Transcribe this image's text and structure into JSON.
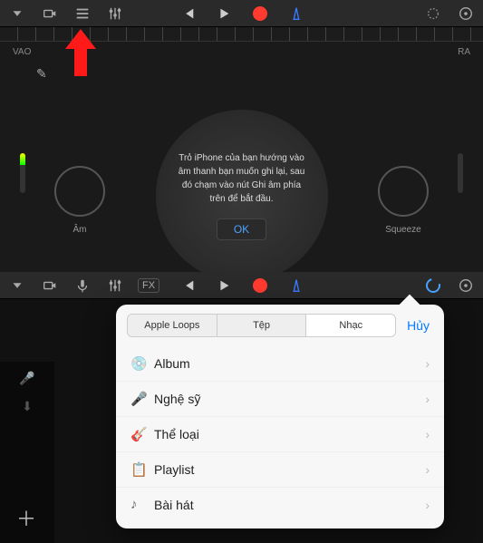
{
  "top": {
    "vao": "VAO",
    "ra": "RA",
    "dial_left": "Âm",
    "dial_right": "Squeeze",
    "tip": "Trỏ iPhone của bạn hướng vào âm thanh bạn muốn ghi lại, sau đó chạm vào nút Ghi âm phía trên để bắt đầu.",
    "ok": "OK"
  },
  "segments": {
    "a": "Apple Loops",
    "b": "Tệp",
    "c": "Nhạc",
    "cancel": "Hủy"
  },
  "menu": [
    {
      "icon": "💿",
      "label": "Album"
    },
    {
      "icon": "🎤",
      "label": "Nghệ sỹ"
    },
    {
      "icon": "🎸",
      "label": "Thể loại"
    },
    {
      "icon": "📋",
      "label": "Playlist"
    },
    {
      "icon": "♪",
      "label": "Bài hát"
    }
  ],
  "fx": "FX"
}
